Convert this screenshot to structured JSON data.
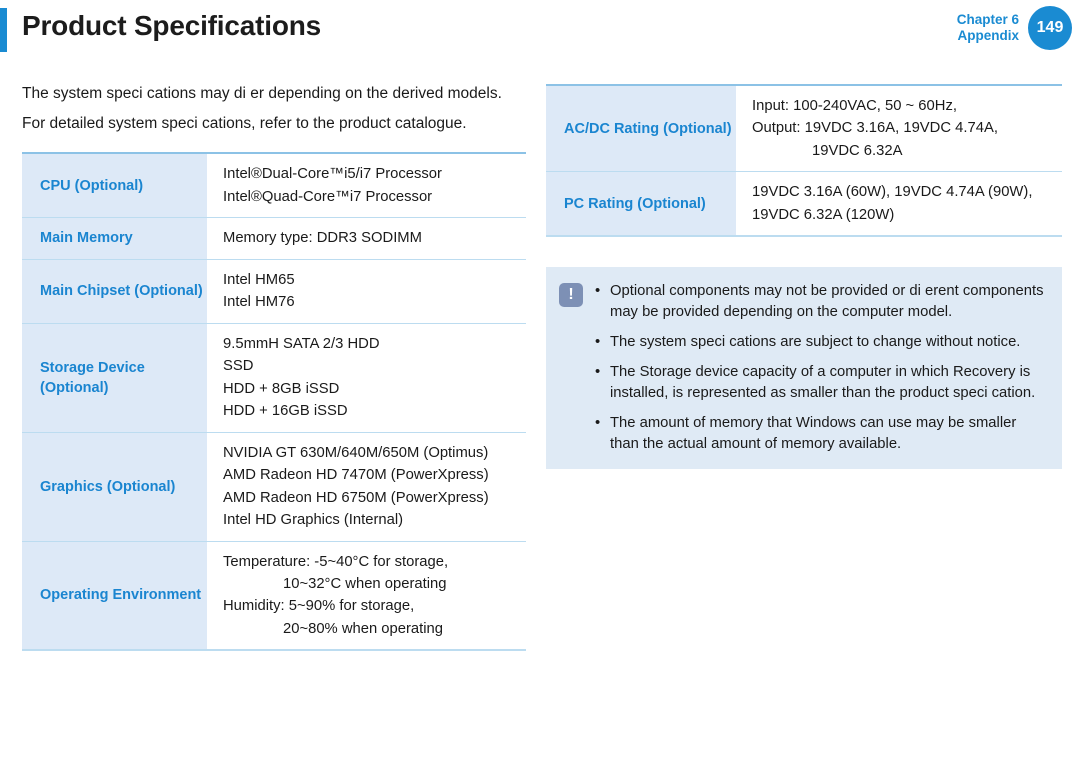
{
  "header": {
    "title": "Product Specifications",
    "chapter_line1": "Chapter 6",
    "chapter_line2": "Appendix",
    "page_number": "149",
    "accent_color": "#1a8bd2"
  },
  "intro": {
    "paragraph1": "The system speci cations may di er depending on the derived models.",
    "paragraph2": "For detailed system speci cations, refer to the product catalogue."
  },
  "left_table": {
    "rows": [
      {
        "label": "CPU (Optional)",
        "values": [
          "Intel®Dual-Core™i5/i7 Processor",
          "Intel®Quad-Core™i7 Processor"
        ]
      },
      {
        "label": "Main Memory",
        "values": [
          "Memory type: DDR3 SODIMM"
        ]
      },
      {
        "label": "Main Chipset (Optional)",
        "values": [
          "Intel HM65",
          "Intel HM76"
        ]
      },
      {
        "label": "Storage Device (Optional)",
        "values": [
          "9.5mmH SATA 2/3 HDD",
          "SSD",
          "HDD + 8GB iSSD",
          "HDD + 16GB iSSD"
        ]
      },
      {
        "label": "Graphics (Optional)",
        "values": [
          "NVIDIA GT 630M/640M/650M (Optimus)",
          "AMD Radeon HD 7470M (PowerXpress)",
          "AMD Radeon HD 6750M (PowerXpress)",
          "Intel HD Graphics (Internal)"
        ]
      },
      {
        "label": "Operating Environment",
        "values": [
          "Temperature: -5~40°C for storage,",
          "10~32°C when operating",
          "Humidity: 5~90% for storage,",
          "20~80% when operating"
        ]
      }
    ]
  },
  "right_table": {
    "rows": [
      {
        "label": "AC/DC Rating (Optional)",
        "values": [
          "Input: 100-240VAC, 50 ~ 60Hz,",
          "Output: 19VDC 3.16A, 19VDC 4.74A,",
          "19VDC 6.32A"
        ]
      },
      {
        "label": "PC Rating (Optional)",
        "values": [
          "19VDC 3.16A (60W), 19VDC 4.74A (90W),",
          "19VDC 6.32A (120W)"
        ]
      }
    ]
  },
  "note": {
    "icon": "exclamation-note-icon",
    "icon_glyph": "!",
    "bullet_glyph": "•",
    "items": [
      "Optional components may not be provided or di erent components may be provided depending on the computer model.",
      "The system speci cations are subject to change without notice.",
      "The Storage device capacity of a computer in which Recovery is installed, is represented as smaller than the product speci cation.",
      "The amount of memory that Windows can use may be smaller than the actual amount of memory available."
    ]
  },
  "colors": {
    "accent_blue": "#1a8bd2",
    "label_text_blue": "#1a85d0",
    "label_cell_bg": "#dde9f7",
    "note_bg": "#dfeaf5",
    "note_icon_bg": "#7d90b5",
    "table_border": "#bcdcf0"
  }
}
